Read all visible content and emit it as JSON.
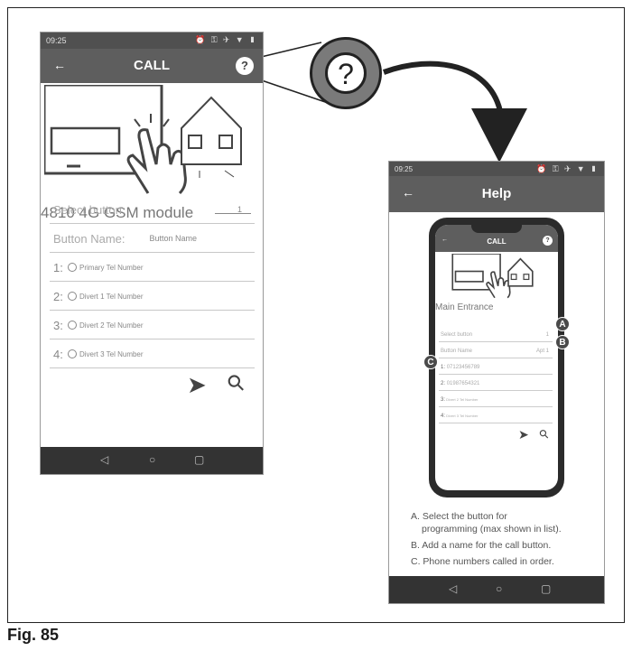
{
  "figure_label": "Fig. 85",
  "left_phone": {
    "status_time": "09:25",
    "status_icons": "⏰ ⚿ ✈ ▼ ▮",
    "back_glyph": "←",
    "title": "CALL",
    "help_glyph": "?",
    "module_title": "4810 4G GSM module",
    "select_button_label": "Select button:",
    "select_button_value": "1",
    "button_name_label": "Button Name:",
    "button_name_value": "Button Name",
    "numbers": [
      {
        "index": "1:",
        "text": "Primary Tel Number"
      },
      {
        "index": "2:",
        "text": "Divert 1 Tel Number"
      },
      {
        "index": "3:",
        "text": "Divert 2 Tel Number"
      },
      {
        "index": "4:",
        "text": "Divert 3 Tel Number"
      }
    ],
    "send_glyph": "➤",
    "search_glyph": "⚲",
    "nav": {
      "back": "◁",
      "home": "○",
      "recents": "▢"
    }
  },
  "zoom": {
    "glyph": "?"
  },
  "right_phone": {
    "status_time": "09:25",
    "status_icons": "⏰ ⚿ ✈ ▼ ▮",
    "back_glyph": "←",
    "title": "Help",
    "mock": {
      "title": "CALL",
      "back_glyph": "←",
      "help_glyph": "?",
      "module_title": "Main Entrance",
      "select_button_label": "Select button",
      "select_button_value": "1",
      "button_name_label": "Button Name",
      "button_name_value": "Apt 1",
      "numbers": [
        {
          "index": "1:",
          "text": "07123456789"
        },
        {
          "index": "2:",
          "text": "01987654321"
        },
        {
          "index": "3:",
          "text": "Divert 2 Tel Number"
        },
        {
          "index": "4:",
          "text": "Divert 3 Tel Number"
        }
      ],
      "send_glyph": "➤",
      "search_glyph": "⚲"
    },
    "badges": {
      "a": "A",
      "b": "B",
      "c": "C"
    },
    "help_items": [
      "A. Select the button for",
      "programming (max shown in list).",
      "B. Add a name for the call button.",
      "C. Phone numbers called in order."
    ],
    "nav": {
      "back": "◁",
      "home": "○",
      "recents": "▢"
    }
  }
}
